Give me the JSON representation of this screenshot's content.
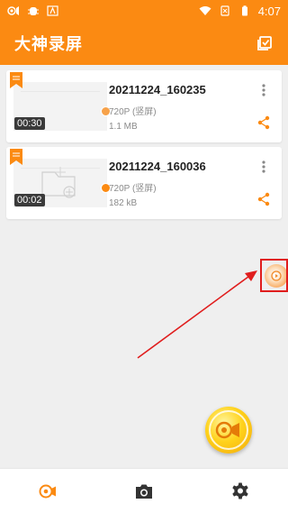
{
  "status_bar": {
    "time": "4:07"
  },
  "app": {
    "title": "大神录屏"
  },
  "recordings": [
    {
      "name": "20211224_160235",
      "resolution": "720P (竖屏)",
      "size": "1.1 MB",
      "duration": "00:30"
    },
    {
      "name": "20211224_160036",
      "resolution": "720P (竖屏)",
      "size": "182 kB",
      "duration": "00:02"
    }
  ],
  "colors": {
    "accent": "#fb8a12",
    "highlight": "#e01d1d",
    "background": "#efefef"
  },
  "icons": {
    "select": "select-all-icon",
    "more": "more-vertical-icon",
    "share": "share-icon",
    "floating": "floating-record-ball-icon",
    "fab": "record-camera-icon",
    "tabs": [
      "record-tab-icon",
      "camera-tab-icon",
      "settings-tab-icon"
    ]
  }
}
